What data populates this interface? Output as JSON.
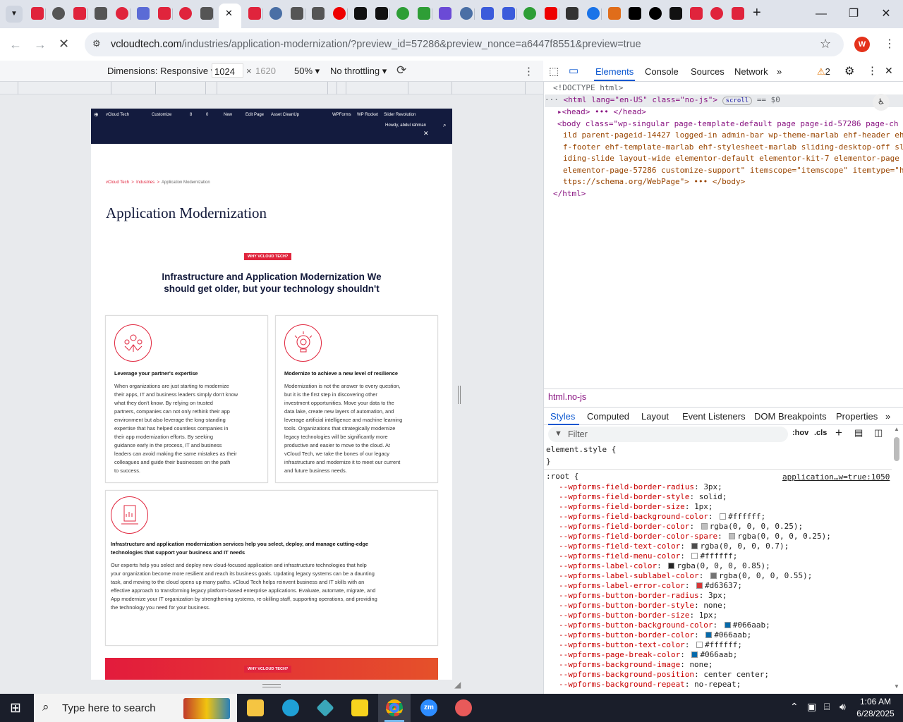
{
  "browser": {
    "active_tab_close": "✕",
    "new_tab": "+",
    "url_host": "vcloudtech.com",
    "url_path": "/industries/application-modernization/?preview_id=57286&preview_nonce=a6447f8551&preview=true",
    "profile_initial": "W"
  },
  "device_toolbar": {
    "dimensions_label": "Dimensions: Responsive",
    "width": "1024",
    "height_placeholder": "1620",
    "zoom": "50%",
    "throttling": "No throttling"
  },
  "site": {
    "admin_bar": {
      "items": [
        "vCloud Tech",
        "Customize",
        "8",
        "0",
        "New",
        "Edit Page",
        "Asset CleanUp",
        "WPForms",
        "WP Rocket",
        "Slider Revolution"
      ],
      "greeting": "Howdy, abdul rahman"
    },
    "breadcrumb": {
      "items": [
        "vCloud Tech",
        "Industries",
        "Application Modernization"
      ],
      "sep": ">"
    },
    "page_title": "Application Modernization",
    "badge": "WHY VCLOUD TECH?",
    "heading": "Infrastructure and Application Modernization We should get older, but your technology shouldn't",
    "cards": [
      {
        "title": "Leverage your partner's expertise",
        "body": [
          "When organizations are just starting to modernize",
          "their apps, IT and business leaders simply don't know",
          "what they don't know. By relying on trusted",
          "partners, companies can not only rethink their app",
          "environment but also leverage the long-standing",
          "expertise that has helped countless companies in",
          "their app modernization efforts. By seeking",
          "guidance early in the process, IT and business",
          "leaders can avoid making the same mistakes as their",
          "colleagues and guide their businesses on the path",
          "to success."
        ]
      },
      {
        "title": "Modernize to achieve a new level of resilience",
        "body": [
          "Modernization is not the answer to every question,",
          "but it is the first step in discovering other",
          "investment opportunities. Move your data to the",
          "data lake, create new layers of automation, and",
          "leverage artificial intelligence and machine learning",
          "tools. Organizations that strategically modernize",
          "legacy technologies will be significantly more",
          "productive and easier to move to the cloud. At",
          "vCloud Tech, we take the bones of our legacy",
          "infrastructure and modernize it to meet our current",
          "and future business needs."
        ]
      },
      {
        "title_lines": [
          "Infrastructure and application modernization services help you select, deploy, and manage cutting-edge",
          "technologies that support your business and IT needs"
        ],
        "body": [
          "Our experts help you select and deploy new cloud-focused application and infrastructure technologies that help",
          "your organization become more resilient and reach its business goals. Updating legacy systems can be a daunting",
          "task, and moving to the cloud opens up many paths. vCloud Tech helps reinvent business and IT skills with an",
          "effective approach to transforming legacy platform-based enterprise applications. Evaluate, automate, migrate, and",
          "App modernize your IT organization by strengthening systems, re-skilling staff, supporting operations, and providing",
          "the technology you need for your business."
        ]
      }
    ],
    "bottom_badge": "WHY VCLOUD TECH?"
  },
  "devtools": {
    "tabs": [
      "Elements",
      "Console",
      "Sources",
      "Network"
    ],
    "issues_count": "2",
    "dom": {
      "doctype": "<!DOCTYPE html>",
      "html_open": "<html lang=\"en-US\" class=\"no-js\">",
      "scroll_badge": "scroll",
      "eq": "== $0",
      "head": "<head> ••• </head>",
      "body_lines": [
        "<body class=\"wp-singular page-template-default page page-id-57286 page-ch",
        "ild parent-pageid-14427 logged-in admin-bar wp-theme-marlab ehf-header eh",
        "f-footer ehf-template-marlab ehf-stylesheet-marlab sliding-desktop-off sl",
        "iding-slide layout-wide elementor-default elementor-kit-7 elementor-page",
        "elementor-page-57286 customize-support\" itemscope=\"itemscope\" itemtype=\"h",
        "ttps://schema.org/WebPage\"> ••• </body>"
      ],
      "html_close": "</html>"
    },
    "crumb": "html.no-js",
    "style_tabs": [
      "Styles",
      "Computed",
      "Layout",
      "Event Listeners",
      "DOM Breakpoints",
      "Properties"
    ],
    "filter_placeholder": "Filter",
    "filter_tools": [
      ":hov",
      ".cls"
    ],
    "element_style": "element.style {",
    "close_brace": "}",
    "root_selector": ":root {",
    "source_link": "application…w=true:1050",
    "props": [
      {
        "name": "--wpforms-field-border-radius",
        "value": "3px;"
      },
      {
        "name": "--wpforms-field-border-style",
        "value": "solid;"
      },
      {
        "name": "--wpforms-field-border-size",
        "value": "1px;"
      },
      {
        "name": "--wpforms-field-background-color",
        "value": "#ffffff;",
        "swatch": "#ffffff"
      },
      {
        "name": "--wpforms-field-border-color",
        "value": "rgba(0, 0, 0, 0.25);",
        "swatch": "#bfbfbf"
      },
      {
        "name": "--wpforms-field-border-color-spare",
        "value": "rgba(0, 0, 0, 0.25);",
        "swatch": "#bfbfbf"
      },
      {
        "name": "--wpforms-field-text-color",
        "value": "rgba(0, 0, 0, 0.7);",
        "swatch": "#4d4d4d"
      },
      {
        "name": "--wpforms-field-menu-color",
        "value": "#ffffff;",
        "swatch": "#ffffff"
      },
      {
        "name": "--wpforms-label-color",
        "value": "rgba(0, 0, 0, 0.85);",
        "swatch": "#262626"
      },
      {
        "name": "--wpforms-label-sublabel-color",
        "value": "rgba(0, 0, 0, 0.55);",
        "swatch": "#737373"
      },
      {
        "name": "--wpforms-label-error-color",
        "value": "#d63637;",
        "swatch": "#d63637"
      },
      {
        "name": "--wpforms-button-border-radius",
        "value": "3px;"
      },
      {
        "name": "--wpforms-button-border-style",
        "value": "none;"
      },
      {
        "name": "--wpforms-button-border-size",
        "value": "1px;"
      },
      {
        "name": "--wpforms-button-background-color",
        "value": "#066aab;",
        "swatch": "#066aab"
      },
      {
        "name": "--wpforms-button-border-color",
        "value": "#066aab;",
        "swatch": "#066aab"
      },
      {
        "name": "--wpforms-button-text-color",
        "value": "#ffffff;",
        "swatch": "#ffffff"
      },
      {
        "name": "--wpforms-page-break-color",
        "value": "#066aab;",
        "swatch": "#066aab"
      },
      {
        "name": "--wpforms-background-image",
        "value": "none;"
      },
      {
        "name": "--wpforms-background-position",
        "value": "center center;"
      },
      {
        "name": "--wpforms-background-repeat",
        "value": "no-repeat;"
      }
    ]
  },
  "taskbar": {
    "search_placeholder": "Type here to search",
    "time": "1:06 AM",
    "date": "6/28/2025"
  },
  "colors": {
    "brand_red": "#e0243c",
    "navy": "#12193a",
    "chrome_blue": "#0b57d0"
  }
}
